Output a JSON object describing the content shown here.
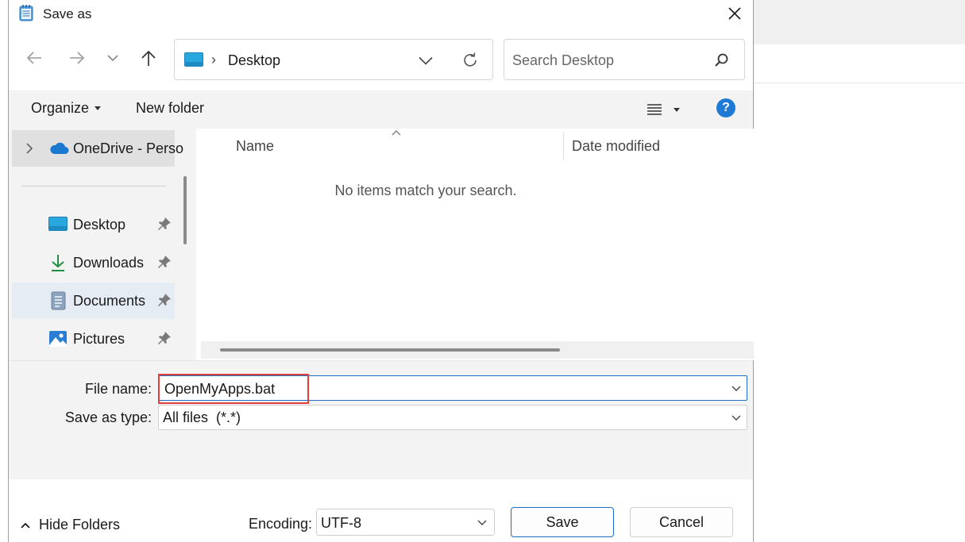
{
  "dialog": {
    "title": "Save as"
  },
  "navigation": {
    "address_current": "Desktop",
    "search_placeholder": "Search Desktop"
  },
  "toolbar": {
    "organize_label": "Organize",
    "new_folder_label": "New folder"
  },
  "nav_pane": {
    "items": [
      {
        "label": "OneDrive - Perso",
        "icon": "cloud-icon",
        "expandable": true
      },
      {
        "label": "Desktop",
        "icon": "desktop-folder-icon",
        "pinned": true
      },
      {
        "label": "Downloads",
        "icon": "download-icon",
        "pinned": true
      },
      {
        "label": "Documents",
        "icon": "documents-icon",
        "pinned": true,
        "selected": true
      },
      {
        "label": "Pictures",
        "icon": "pictures-icon",
        "pinned": true
      }
    ]
  },
  "file_list": {
    "columns": [
      "Name",
      "Date modified"
    ],
    "empty_message": "No items match your search."
  },
  "form": {
    "file_name_label": "File name:",
    "file_name_value": "OpenMyApps.bat",
    "save_type_label": "Save as type:",
    "save_type_value": "All files  (*.*)"
  },
  "footer": {
    "hide_folders_label": "Hide Folders",
    "encoding_label": "Encoding:",
    "encoding_value": "UTF-8",
    "save_label": "Save",
    "cancel_label": "Cancel"
  },
  "colors": {
    "accent": "#1b6ec2",
    "highlight": "#e0403c",
    "help": "#1e7ad4"
  }
}
